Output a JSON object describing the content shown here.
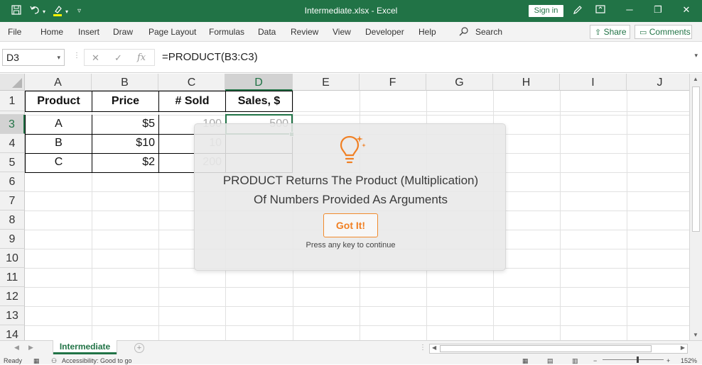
{
  "titlebar": {
    "title": "Intermediate.xlsx  -  Excel",
    "signin": "Sign in",
    "minimize": "─",
    "restore": "❐",
    "close": "✕"
  },
  "menu": {
    "items": [
      "File",
      "Home",
      "Insert",
      "Draw",
      "Page Layout",
      "Formulas",
      "Data",
      "Review",
      "View",
      "Developer",
      "Help"
    ],
    "search": "Search",
    "share": "Share",
    "comments": "Comments"
  },
  "formula_bar": {
    "name_box": "D3",
    "formula": "=PRODUCT(B3:C3)",
    "fx": "fx"
  },
  "columns": [
    "A",
    "B",
    "C",
    "D",
    "E",
    "F",
    "G",
    "H",
    "I",
    "J"
  ],
  "active_column": "D",
  "rows": [
    "1",
    "3",
    "4",
    "5",
    "6",
    "7",
    "8",
    "9",
    "10",
    "11",
    "12",
    "13",
    "14"
  ],
  "active_row": "3",
  "table": {
    "headers": [
      "Product",
      "Price",
      "# Sold",
      "Sales, $"
    ],
    "rows": [
      {
        "product": "A",
        "price": "$5",
        "sold": "100",
        "sales": "500"
      },
      {
        "product": "B",
        "price": "$10",
        "sold": "10",
        "sales": ""
      },
      {
        "product": "C",
        "price": "$2",
        "sold": "200",
        "sales": ""
      }
    ]
  },
  "sheet_tab": "Intermediate",
  "status": {
    "ready": "Ready",
    "accessibility": "Accessibility: Good to go",
    "zoom": "152%"
  },
  "tip": {
    "line1": "PRODUCT Returns The Product (Multiplication)",
    "line2": "Of Numbers Provided As Arguments",
    "button": "Got It!",
    "hint": "Press any key to continue",
    "accent": "#f08024"
  },
  "theme": {
    "excel_green": "#217346"
  }
}
